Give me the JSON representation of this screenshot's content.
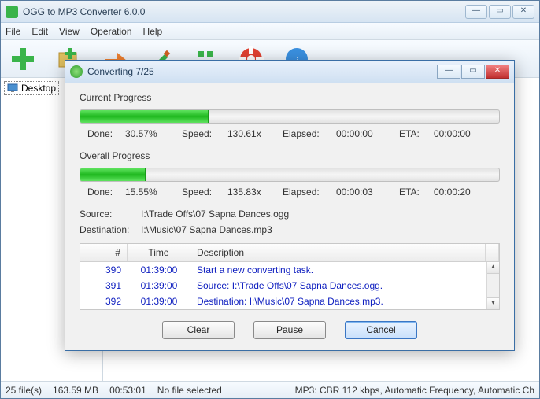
{
  "app": {
    "title": "OGG to MP3 Converter 6.0.0"
  },
  "menu": {
    "file": "File",
    "edit": "Edit",
    "view": "View",
    "operation": "Operation",
    "help": "Help"
  },
  "tree": {
    "desktop": "Desktop"
  },
  "status": {
    "files": "25 file(s)",
    "size": "163.59 MB",
    "dur": "00:53:01",
    "sel": "No file selected",
    "fmt": "MP3:  CBR 112 kbps, Automatic Frequency, Automatic Ch"
  },
  "dialog": {
    "title": "Converting 7/25",
    "current_label": "Current Progress",
    "overall_label": "Overall Progress",
    "current": {
      "done_label": "Done:",
      "done": "30.57%",
      "speed_label": "Speed:",
      "speed": "130.61x",
      "elapsed_label": "Elapsed:",
      "elapsed": "00:00:00",
      "eta_label": "ETA:",
      "eta": "00:00:00",
      "pct": 30.57
    },
    "overall": {
      "done_label": "Done:",
      "done": "15.55%",
      "speed_label": "Speed:",
      "speed": "135.83x",
      "elapsed_label": "Elapsed:",
      "elapsed": "00:00:03",
      "eta_label": "ETA:",
      "eta": "00:00:20",
      "pct": 15.55
    },
    "source_label": "Source:",
    "source": "I:\\Trade Offs\\07  Sapna Dances.ogg",
    "dest_label": "Destination:",
    "dest": "I:\\Music\\07  Sapna Dances.mp3",
    "log_head": {
      "num": "#",
      "time": "Time",
      "desc": "Description"
    },
    "log": [
      {
        "n": "390",
        "t": "01:39:00",
        "d": "Start a new converting task."
      },
      {
        "n": "391",
        "t": "01:39:00",
        "d": "Source:  I:\\Trade Offs\\07  Sapna Dances.ogg."
      },
      {
        "n": "392",
        "t": "01:39:00",
        "d": "Destination: I:\\Music\\07  Sapna Dances.mp3."
      }
    ],
    "buttons": {
      "clear": "Clear",
      "pause": "Pause",
      "cancel": "Cancel"
    }
  }
}
